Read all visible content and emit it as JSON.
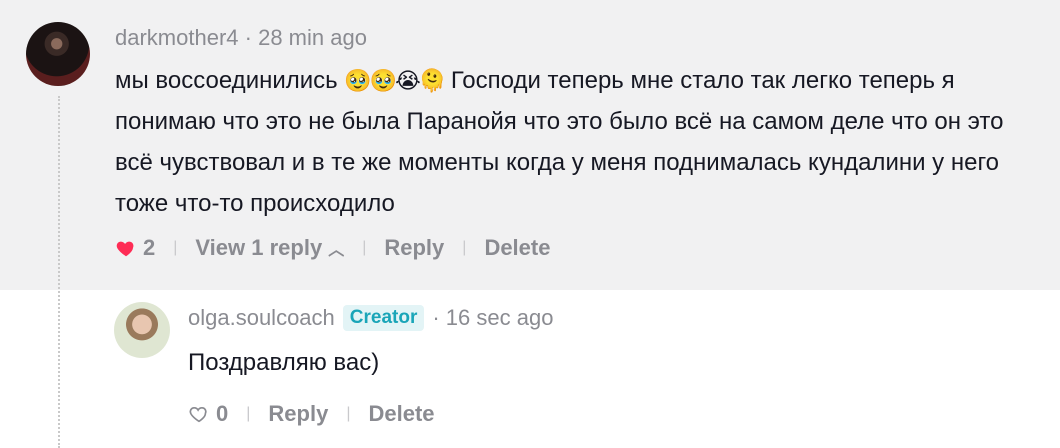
{
  "main_comment": {
    "username": "darkmother4",
    "time": "· 28 min ago",
    "text_before_emoji": "мы воссоединились ",
    "emojis": "🥹🥹😭🫠",
    "text_after_emoji": " Господи теперь мне стало так легко теперь я понимаю что это не была Паранойя что это было всё на самом деле что он это всё чувствовал и в те же моменты когда у меня поднималась кундалини у него тоже что-то происходило",
    "likes": "2",
    "view_replies": "View 1 reply",
    "reply_label": "Reply",
    "delete_label": "Delete",
    "like_color": "#fe2c55"
  },
  "reply_comment": {
    "username": "olga.soulcoach",
    "badge": "Creator",
    "time": "· 16 sec ago",
    "text": "Поздравляю вас)",
    "likes": "0",
    "reply_label": "Reply",
    "delete_label": "Delete"
  },
  "icons": {
    "liked": "heart-filled-icon",
    "unliked": "heart-outline-icon",
    "expand": "chevron-up-icon"
  }
}
